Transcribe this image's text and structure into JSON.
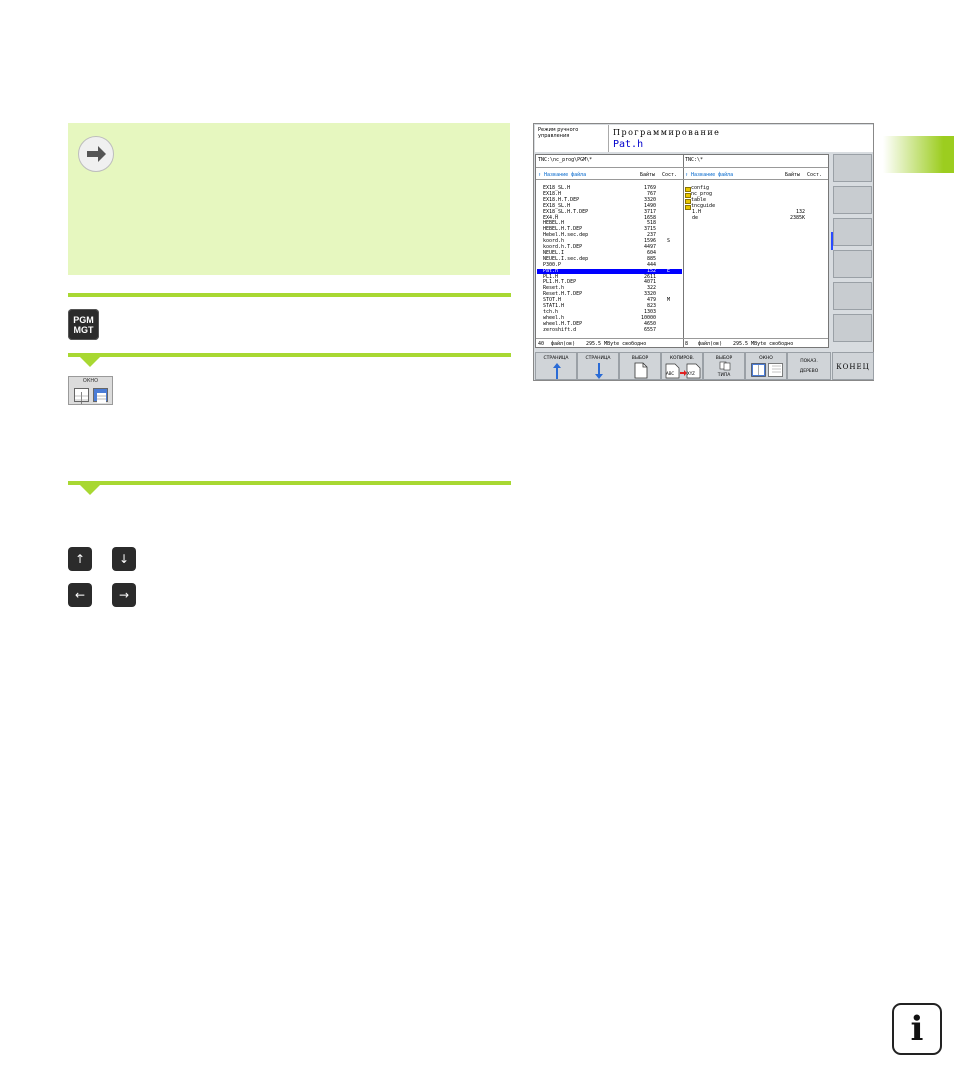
{
  "left_column": {
    "pgm_key": {
      "line1": "PGM",
      "line2": "MGT"
    },
    "window_soft_key_label": "ОКНО",
    "arrow_keys": {
      "up": "↑",
      "down": "↓",
      "left": "←",
      "right": "→"
    }
  },
  "screen": {
    "mode_label": "Режим ручного управления",
    "program_title": "Программирование",
    "program_file": "Pat.h",
    "left_pane": {
      "path": "TNC:\\nc_prog\\PGM\\*",
      "header_name": "Название файла",
      "header_size": "Байты",
      "header_status": "Сост.",
      "files": [
        {
          "name": "EX18_SL.H",
          "size": "1769",
          "status": ""
        },
        {
          "name": "EX18.H",
          "size": "767",
          "status": ""
        },
        {
          "name": "EX18.H.T.DEP",
          "size": "3320",
          "status": ""
        },
        {
          "name": "EX18_SL.H",
          "size": "1490",
          "status": ""
        },
        {
          "name": "EX18_SL.H.T.DEP",
          "size": "3717",
          "status": ""
        },
        {
          "name": "EX4.H",
          "size": "1658",
          "status": ""
        },
        {
          "name": "HEBEL.H",
          "size": "518",
          "status": ""
        },
        {
          "name": "HEBEL.H.T.DEP",
          "size": "3715",
          "status": ""
        },
        {
          "name": "Hebel.H.sec.dep",
          "size": "237",
          "status": ""
        },
        {
          "name": "koord.h",
          "size": "1596",
          "status": "S"
        },
        {
          "name": "koord.h.T.DEP",
          "size": "4497",
          "status": ""
        },
        {
          "name": "NEUEL.I",
          "size": "604",
          "status": ""
        },
        {
          "name": "NEUEL.I.sec.dep",
          "size": "885",
          "status": ""
        },
        {
          "name": "P300.P",
          "size": "444",
          "status": ""
        },
        {
          "name": "Pat.h",
          "size": "152",
          "status": "E",
          "selected": true
        },
        {
          "name": "PL1.H",
          "size": "2611",
          "status": ""
        },
        {
          "name": "PL1.H.T.DEP",
          "size": "4071",
          "status": ""
        },
        {
          "name": "Reset.h",
          "size": "322",
          "status": ""
        },
        {
          "name": "Reset.H.T.DEP",
          "size": "3320",
          "status": ""
        },
        {
          "name": "STOT.H",
          "size": "479",
          "status": "M"
        },
        {
          "name": "STAT1.H",
          "size": "823",
          "status": ""
        },
        {
          "name": "tch.h",
          "size": "1303",
          "status": ""
        },
        {
          "name": "wheel.h",
          "size": "10000",
          "status": ""
        },
        {
          "name": "wheel.H.T.DEP",
          "size": "4650",
          "status": ""
        },
        {
          "name": "zeroshift.d",
          "size": "6557",
          "status": ""
        }
      ],
      "status_count": "40",
      "status_text": "файл(ов)",
      "status_free": "295.5 MByte свободно"
    },
    "right_pane": {
      "path": "TNC:\\*",
      "header_name": "Название файла",
      "header_size": "Байты",
      "header_status": "Сост.",
      "entries": [
        {
          "name": "config",
          "size": "",
          "folder": true
        },
        {
          "name": "nc_prog",
          "size": "",
          "folder": true
        },
        {
          "name": "table",
          "size": "",
          "folder": true
        },
        {
          "name": "tncguide",
          "size": "",
          "folder": true
        },
        {
          "name": "1.H",
          "size": "132",
          "folder": false
        },
        {
          "name": "de",
          "size": "2385K",
          "folder": false
        }
      ],
      "status_count": "8",
      "status_text": "файл(ов)",
      "status_free": "295.5 MByte свободно"
    },
    "softkeys": {
      "page_up": "СТРАНИЦА",
      "page_down": "СТРАНИЦА",
      "select": "ВЫБОР",
      "copy": "КОПИРОВ.",
      "copy_from": "ABC",
      "copy_to": "XYZ",
      "select_type_1": "ВЫБОР",
      "select_type_2": "ТИПА",
      "window": "ОКНО",
      "show_tree_1": "ПОКАЗ.",
      "show_tree_2": "ДЕРЕВО",
      "end": "КОНЕЦ"
    }
  },
  "info_icon_glyph": "i",
  "colors": {
    "accent_green": "#a8d832",
    "note_bg": "#e6f7bf",
    "select_blue": "#0000ff"
  }
}
